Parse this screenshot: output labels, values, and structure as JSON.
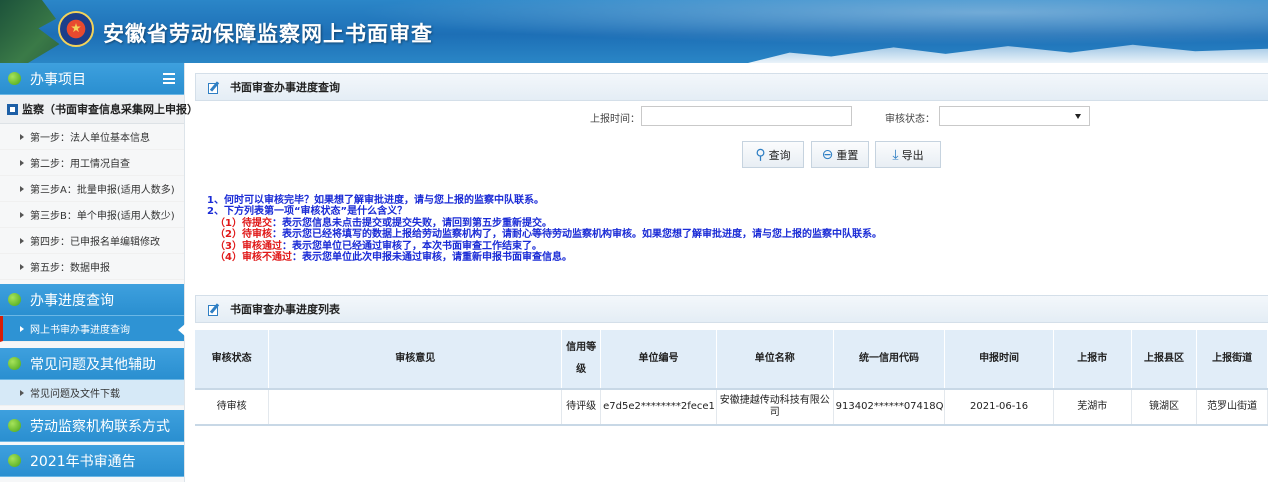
{
  "header": {
    "title": "安徽省劳动保障监察网上书面审查",
    "logo_icon": "emblem-logo"
  },
  "sidebar": {
    "menu_title": "办事项目",
    "section_title": "监察（书面审查信息采集网上申报）",
    "steps": [
      "第一步：法人单位基本信息",
      "第二步：用工情况自查",
      "第三步A：批量申报(适用人数多)",
      "第三步B：单个申报(适用人数少)",
      "第四步：已申报名单编辑修改",
      "第五步：数据申报"
    ],
    "progress_title": "办事进度查询",
    "progress_item": "网上书审办事进度查询",
    "faq_title": "常见问题及其他辅助",
    "faq_item": "常见问题及文件下载",
    "contact_title": "劳动监察机构联系方式",
    "notice_title": "2021年书审通告"
  },
  "query": {
    "title": "书面审查办事进度查询",
    "report_time_label": "上报时间：",
    "report_time_value": "",
    "status_label": "审核状态：",
    "status_value": "",
    "btn_search": "查询",
    "btn_reset": "重置",
    "btn_export": "导出"
  },
  "notes": {
    "q1": "1、何时可以审核完毕？如果想了解审批进度，请与您上报的监察中队联系。",
    "q2": "2、下方列表第一项“审核状态”是什么含义？",
    "s1_key": "（1）待提交",
    "s1_text": "：表示您信息未点击提交或提交失败，请回到第五步重新提交。",
    "s2_key": "（2）待审核",
    "s2_text": "：表示您已经将填写的数据上报给劳动监察机构了，请耐心等待劳动监察机构审核。如果您想了解审批进度，请与您上报的监察中队联系。",
    "s3_key": "（3）审核通过",
    "s3_text": "：表示您单位已经通过审核了，本次书面审查工作结束了。",
    "s4_key": "（4）审核不通过",
    "s4_text": "：表示您单位此次申报未通过审核，请重新申报书面审查信息。"
  },
  "list": {
    "title": "书面审查办事进度列表",
    "columns": [
      "审核状态",
      "审核意见",
      "信用等级",
      "单位编号",
      "单位名称",
      "统一信用代码",
      "申报时间",
      "上报市",
      "上报县区",
      "上报街道"
    ],
    "rows": [
      [
        "待审核",
        "",
        "待评级",
        "e7d5e2********2fece1",
        "安徽捷越传动科技有限公司",
        "913402******07418Q",
        "2021-06-16",
        "芜湖市",
        "镜湖区",
        "范罗山街道"
      ]
    ]
  },
  "colors": {
    "header_blue": "#1d6fb6",
    "menu_blue": "#2a8fd0",
    "note_blue": "#1a2bd6",
    "note_red": "#e01818"
  }
}
